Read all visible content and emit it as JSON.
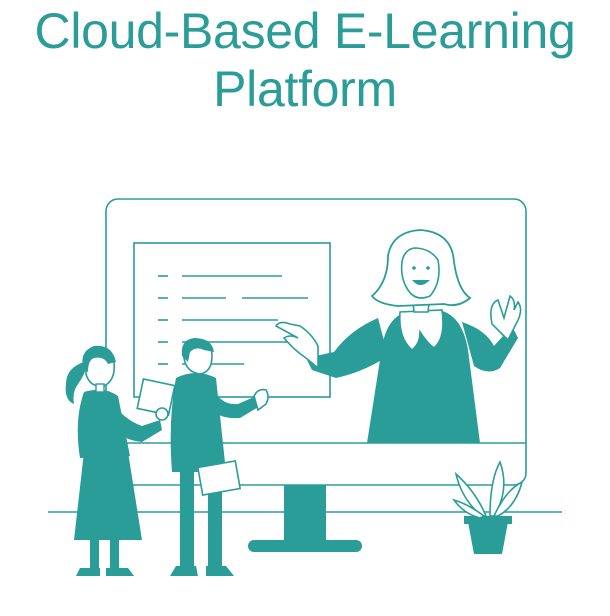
{
  "title": {
    "line1": "Cloud-Based E-Learning",
    "line2": "Platform"
  },
  "colors": {
    "accent": "#2A9D99",
    "background": "#FFFFFF"
  },
  "illustration": {
    "icons": [
      "monitor-icon",
      "teacher-icon",
      "student-icon",
      "plant-icon",
      "slide-board-icon"
    ]
  }
}
